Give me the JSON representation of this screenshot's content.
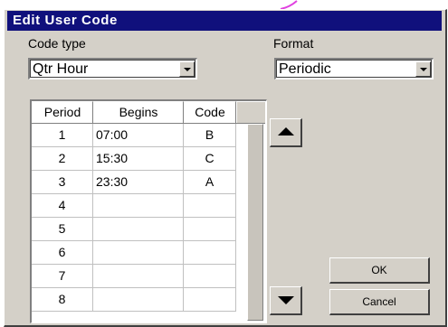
{
  "window": {
    "title": "Edit User Code"
  },
  "code_type": {
    "label": "Code type",
    "value": "Qtr Hour"
  },
  "format": {
    "label": "Format",
    "value": "Periodic"
  },
  "table": {
    "columns": [
      "Period",
      "Begins",
      "Code"
    ],
    "rows": [
      {
        "period": "1",
        "begins": "07:00",
        "code": "B"
      },
      {
        "period": "2",
        "begins": "15:30",
        "code": "C"
      },
      {
        "period": "3",
        "begins": "23:30",
        "code": "A"
      },
      {
        "period": "4",
        "begins": "",
        "code": ""
      },
      {
        "period": "5",
        "begins": "",
        "code": ""
      },
      {
        "period": "6",
        "begins": "",
        "code": ""
      },
      {
        "period": "7",
        "begins": "",
        "code": ""
      },
      {
        "period": "8",
        "begins": "",
        "code": ""
      }
    ]
  },
  "buttons": {
    "ok": "OK",
    "cancel": "Cancel"
  },
  "icons": {
    "up": "arrow-up-icon",
    "down": "arrow-down-icon",
    "dropdown": "chevron-down-icon"
  },
  "colors": {
    "title_bar": "#10107c",
    "face": "#d4d0c8",
    "annotation_stroke": "#e040e0"
  }
}
